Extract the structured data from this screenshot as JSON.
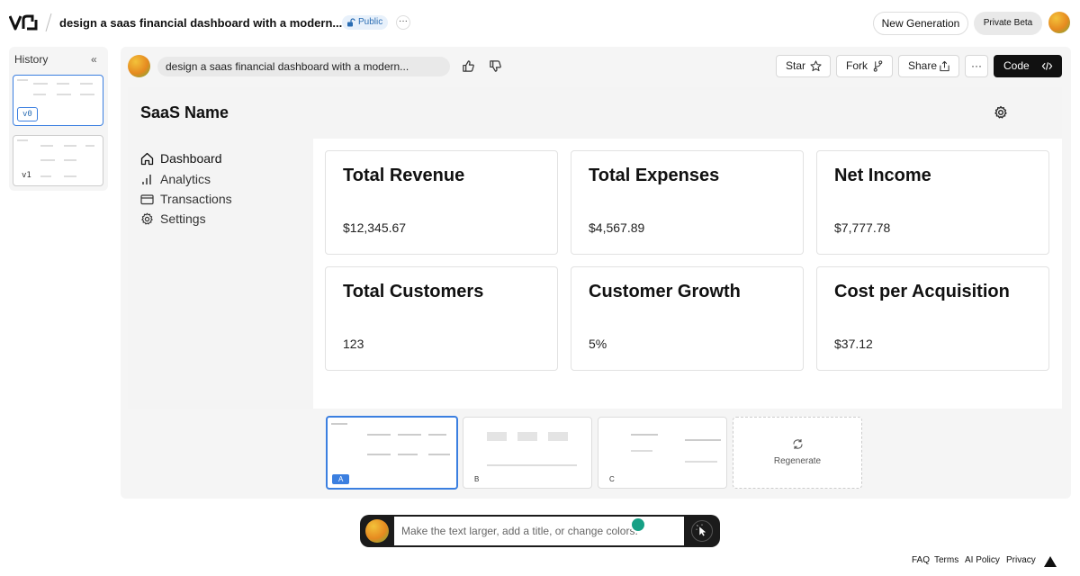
{
  "header": {
    "title": "design a saas financial dashboard with a modern...",
    "visibility_badge": "Public",
    "more_label": "···",
    "new_generation_label": "New Generation",
    "private_beta_label": "Private Beta"
  },
  "history": {
    "title": "History",
    "collapse_label": "«",
    "versions": [
      {
        "label": "v0",
        "selected": true
      },
      {
        "label": "v1",
        "selected": false
      }
    ]
  },
  "message": {
    "prompt": "design a saas financial dashboard with a modern...",
    "actions": {
      "star": "Star",
      "fork": "Fork",
      "share": "Share",
      "more": "···",
      "code": "Code"
    }
  },
  "preview": {
    "app_name": "SaaS Name",
    "nav": [
      {
        "label": "Dashboard",
        "icon": "home-icon"
      },
      {
        "label": "Analytics",
        "icon": "bar-chart-icon"
      },
      {
        "label": "Transactions",
        "icon": "credit-card-icon"
      },
      {
        "label": "Settings",
        "icon": "gear-icon"
      }
    ],
    "cards": [
      {
        "title": "Total Revenue",
        "value": "$12,345.67"
      },
      {
        "title": "Total Expenses",
        "value": "$4,567.89"
      },
      {
        "title": "Net Income",
        "value": "$7,777.78"
      },
      {
        "title": "Total Customers",
        "value": "123"
      },
      {
        "title": "Customer Growth",
        "value": "5%"
      },
      {
        "title": "Cost per Acquisition",
        "value": "$37.12"
      }
    ]
  },
  "variants": {
    "items": [
      {
        "label": "A",
        "selected": true
      },
      {
        "label": "B",
        "selected": false
      },
      {
        "label": "C",
        "selected": false
      }
    ],
    "regenerate_label": "Regenerate"
  },
  "chat": {
    "placeholder": "Make the text larger, add a title, or change colors."
  },
  "footer": {
    "links": [
      "FAQ",
      "Terms",
      "AI Policy",
      "Privacy"
    ]
  },
  "colors": {
    "accent": "#3b7fe0",
    "code_button": "#111111",
    "chatbar": "#1b1b1b"
  }
}
